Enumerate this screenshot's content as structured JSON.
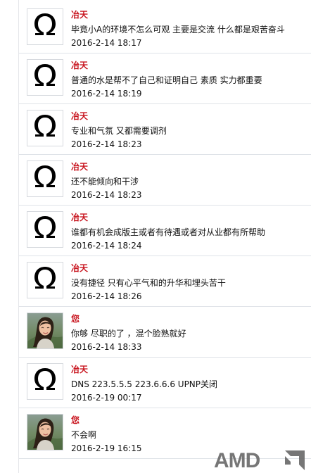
{
  "comments": [
    {
      "author": "冶天",
      "avatar": "omega-icon",
      "text": "毕竟小A的环境不怎么可观 主要是交流 什么都是艰苦奋斗",
      "time": "2016-2-14 18:17"
    },
    {
      "author": "冶天",
      "avatar": "omega-icon",
      "text": "普通的水是帮不了自己和证明自己 素质 实力都重要",
      "time": "2016-2-14 18:19"
    },
    {
      "author": "冶天",
      "avatar": "omega-icon",
      "text": "专业和气氛 又都需要调剂",
      "time": "2016-2-14 18:23"
    },
    {
      "author": "冶天",
      "avatar": "omega-icon",
      "text": "还不能倾向和干涉",
      "time": "2016-2-14 18:23"
    },
    {
      "author": "冶天",
      "avatar": "omega-icon",
      "text": "谁都有机会成版主或者有待遇或者对从业都有所帮助",
      "time": "2016-2-14 18:24"
    },
    {
      "author": "冶天",
      "avatar": "omega-icon",
      "text": "没有捷径 只有心平气和的升华和埋头苦干",
      "time": "2016-2-14 18:26"
    },
    {
      "author": "您",
      "avatar": "user-photo",
      "text": "你够 尽职的了 ，混个脸熟就好",
      "time": "2016-2-14 18:33"
    },
    {
      "author": "冶天",
      "avatar": "omega-icon",
      "text": "DNS 223.5.5.5 223.6.6.6 UPNP关闭",
      "time": "2016-2-19 00:17"
    },
    {
      "author": "您",
      "avatar": "user-photo",
      "text": "不会啊",
      "time": "2016-2-19 16:15"
    }
  ],
  "watermark": {
    "text": "AMD"
  }
}
